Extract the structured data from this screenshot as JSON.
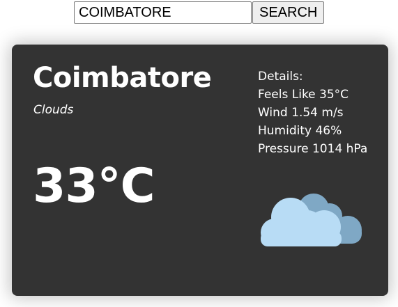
{
  "search": {
    "value": "COIMBATORE",
    "button_label": "SEARCH"
  },
  "weather": {
    "city": "Coimbatore",
    "condition": "Clouds",
    "temperature": "33°C",
    "icon": "clouds-icon",
    "details": {
      "heading": "Details:",
      "feels_like": "Feels Like 35°C",
      "wind": "Wind 1.54 m/s",
      "humidity": "Humidity 46%",
      "pressure": "Pressure 1014 hPa"
    }
  },
  "colors": {
    "card_background": "#333333",
    "text": "#ffffff",
    "cloud_front": "#b8dcf5",
    "cloud_back": "#7fa8c5"
  }
}
